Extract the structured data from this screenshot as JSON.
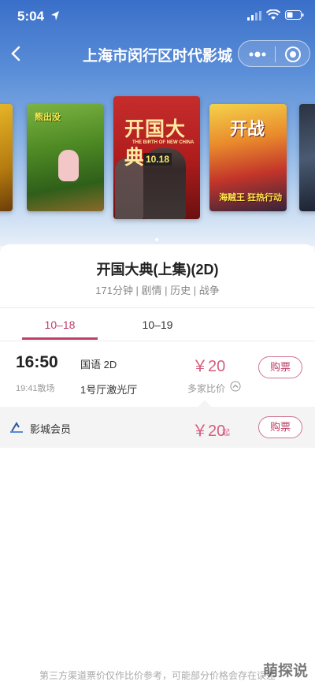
{
  "status_bar": {
    "time": "5:04"
  },
  "nav": {
    "title": "上海市闵行区时代影城"
  },
  "posters": [
    {
      "title": ""
    },
    {
      "title": "熊出没"
    },
    {
      "title": "开国大典",
      "subtitle": "THE BIRTH OF NEW CHINA",
      "date": "10.18"
    },
    {
      "title": "开战",
      "subtitle": "海贼王 狂热行动"
    },
    {
      "title": ""
    }
  ],
  "movie": {
    "title": "开国大典(上集)(2D)",
    "meta": "171分钟 | 剧情 | 历史 | 战争"
  },
  "tabs": [
    {
      "label": "10–18",
      "active": true
    },
    {
      "label": "10–19",
      "active": false
    }
  ],
  "showtime": {
    "start": "16:50",
    "end": "19:41散场",
    "language": "国语 2D",
    "hall": "1号厅激光厅",
    "price": "￥20",
    "compare_label": "多家比价",
    "buy_label": "购票"
  },
  "member": {
    "label": "影城会员",
    "price": "￥20",
    "suffix": "起",
    "buy_label": "购票"
  },
  "footer": {
    "note": "第三方渠道票价仅作比价参考，可能部分价格会存在误差"
  },
  "watermark": "萌探说",
  "colors": {
    "accent": "#c0406a",
    "price": "#d65e7d",
    "header_blue": "#3a6fc9"
  }
}
